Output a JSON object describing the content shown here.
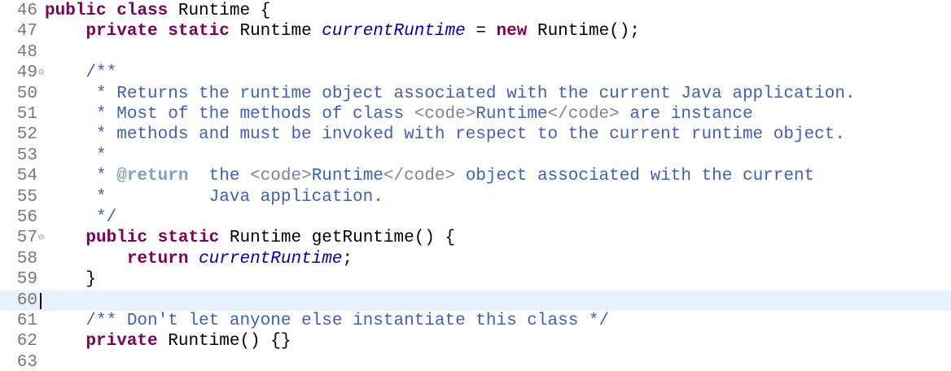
{
  "lines": [
    {
      "n": "46",
      "fold": "",
      "tokens": [
        {
          "t": "public",
          "c": "kw"
        },
        {
          "t": " ",
          "c": ""
        },
        {
          "t": "class",
          "c": "kw"
        },
        {
          "t": " Runtime {",
          "c": ""
        }
      ]
    },
    {
      "n": "47",
      "fold": "",
      "tokens": [
        {
          "t": "    ",
          "c": ""
        },
        {
          "t": "private",
          "c": "kw"
        },
        {
          "t": " ",
          "c": ""
        },
        {
          "t": "static",
          "c": "kw"
        },
        {
          "t": " Runtime ",
          "c": ""
        },
        {
          "t": "currentRuntime",
          "c": "it"
        },
        {
          "t": " = ",
          "c": ""
        },
        {
          "t": "new",
          "c": "kw"
        },
        {
          "t": " Runtime();",
          "c": ""
        }
      ]
    },
    {
      "n": "48",
      "fold": "",
      "tokens": []
    },
    {
      "n": "49",
      "fold": "⊖",
      "tokens": [
        {
          "t": "    ",
          "c": ""
        },
        {
          "t": "/**",
          "c": "jd"
        }
      ]
    },
    {
      "n": "50",
      "fold": "",
      "tokens": [
        {
          "t": "     * Returns the runtime object associated with the current Java application.",
          "c": "jd"
        }
      ]
    },
    {
      "n": "51",
      "fold": "",
      "tokens": [
        {
          "t": "     * Most of the methods of class ",
          "c": "jd"
        },
        {
          "t": "<code>",
          "c": "tag"
        },
        {
          "t": "Runtime",
          "c": "jd"
        },
        {
          "t": "</code>",
          "c": "tag"
        },
        {
          "t": " are instance",
          "c": "jd"
        }
      ]
    },
    {
      "n": "52",
      "fold": "",
      "tokens": [
        {
          "t": "     * methods and must be invoked with respect to the current runtime object.",
          "c": "jd"
        }
      ]
    },
    {
      "n": "53",
      "fold": "",
      "tokens": [
        {
          "t": "     *",
          "c": "jd"
        }
      ]
    },
    {
      "n": "54",
      "fold": "",
      "tokens": [
        {
          "t": "     * ",
          "c": "jd"
        },
        {
          "t": "@return",
          "c": "tg"
        },
        {
          "t": "  the ",
          "c": "jd"
        },
        {
          "t": "<code>",
          "c": "tag"
        },
        {
          "t": "Runtime",
          "c": "jd"
        },
        {
          "t": "</code>",
          "c": "tag"
        },
        {
          "t": " object associated with the current",
          "c": "jd"
        }
      ]
    },
    {
      "n": "55",
      "fold": "",
      "tokens": [
        {
          "t": "     *          Java application.",
          "c": "jd"
        }
      ]
    },
    {
      "n": "56",
      "fold": "",
      "tokens": [
        {
          "t": "     */",
          "c": "jd"
        }
      ]
    },
    {
      "n": "57",
      "fold": "⊖",
      "tokens": [
        {
          "t": "    ",
          "c": ""
        },
        {
          "t": "public",
          "c": "kw"
        },
        {
          "t": " ",
          "c": ""
        },
        {
          "t": "static",
          "c": "kw"
        },
        {
          "t": " Runtime getRuntime() {",
          "c": ""
        }
      ]
    },
    {
      "n": "58",
      "fold": "",
      "tokens": [
        {
          "t": "        ",
          "c": ""
        },
        {
          "t": "return",
          "c": "kw"
        },
        {
          "t": " ",
          "c": ""
        },
        {
          "t": "currentRuntime",
          "c": "it"
        },
        {
          "t": ";",
          "c": ""
        }
      ]
    },
    {
      "n": "59",
      "fold": "",
      "tokens": [
        {
          "t": "    }",
          "c": ""
        }
      ]
    },
    {
      "n": "60",
      "fold": "",
      "current": true,
      "tokens": []
    },
    {
      "n": "61",
      "fold": "",
      "tokens": [
        {
          "t": "    ",
          "c": ""
        },
        {
          "t": "/** Don't let anyone else instantiate this class */",
          "c": "jd"
        }
      ]
    },
    {
      "n": "62",
      "fold": "",
      "tokens": [
        {
          "t": "    ",
          "c": ""
        },
        {
          "t": "private",
          "c": "kw"
        },
        {
          "t": " Runtime() {}",
          "c": ""
        }
      ]
    },
    {
      "n": "63",
      "fold": "",
      "tokens": []
    }
  ]
}
